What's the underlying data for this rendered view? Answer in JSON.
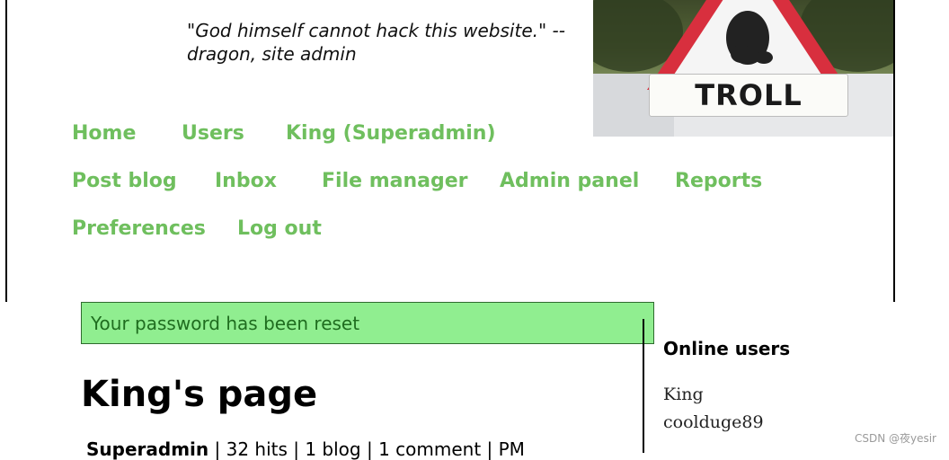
{
  "header": {
    "quote": "\"God himself cannot hack this website.\" -- dragon, site admin",
    "image_sign_text": "TROLL"
  },
  "nav": {
    "row1": [
      "Home",
      "Users",
      "King (Superadmin)"
    ],
    "row2": [
      "Post blog",
      "Inbox",
      "File manager",
      "Admin panel",
      "Reports"
    ],
    "row3": [
      "Preferences",
      "Log out"
    ]
  },
  "alert": {
    "message": "Your password has been reset",
    "background": "#90ee90",
    "text_color": "#1f6d1f"
  },
  "main": {
    "title": "King's page",
    "stats_role": "Superadmin",
    "stats_rest": " | 32 hits | 1 blog | 1 comment | PM"
  },
  "sidebar": {
    "title": "Online users",
    "users": [
      "King",
      "coolduge89"
    ]
  },
  "watermark": "CSDN @夜yesir",
  "colors": {
    "nav_link": "#6fbf5e"
  }
}
